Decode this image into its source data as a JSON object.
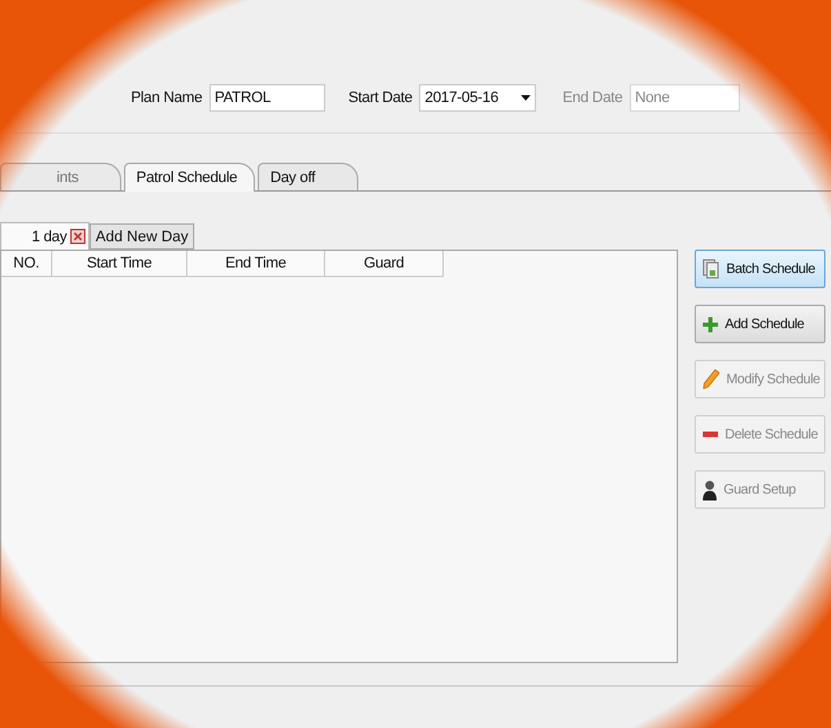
{
  "form": {
    "plan_name_label": "Plan Name",
    "plan_name": "PATROL",
    "start_date_label": "Start Date",
    "start_date": "2017-05-16",
    "end_date_label": "End Date",
    "end_date_placeholder": "None",
    "end_date_disabled": true
  },
  "tabs": [
    {
      "label": "ints",
      "selected": false
    },
    {
      "label": "Patrol Schedule",
      "selected": true
    },
    {
      "label": "Day off",
      "selected": false
    }
  ],
  "day_tabs": [
    {
      "label": "1 day",
      "selected": true
    }
  ],
  "add_day_button": "Add New Day",
  "table": {
    "columns": [
      "NO.",
      "Start Time",
      "End Time",
      "Guard"
    ]
  },
  "actions": [
    {
      "kind": "batch",
      "label": "Batch Schedule",
      "highlighted": true,
      "disabled": false
    },
    {
      "kind": "add",
      "label": "Add Schedule",
      "highlighted": false,
      "disabled": false
    },
    {
      "kind": "edit",
      "label": "Modify Schedule",
      "highlighted": false,
      "disabled": true
    },
    {
      "kind": "delete",
      "label": "Delete Schedule",
      "highlighted": false,
      "disabled": true
    },
    {
      "kind": "guard",
      "label": "Guard Setup",
      "highlighted": false,
      "disabled": true
    }
  ]
}
